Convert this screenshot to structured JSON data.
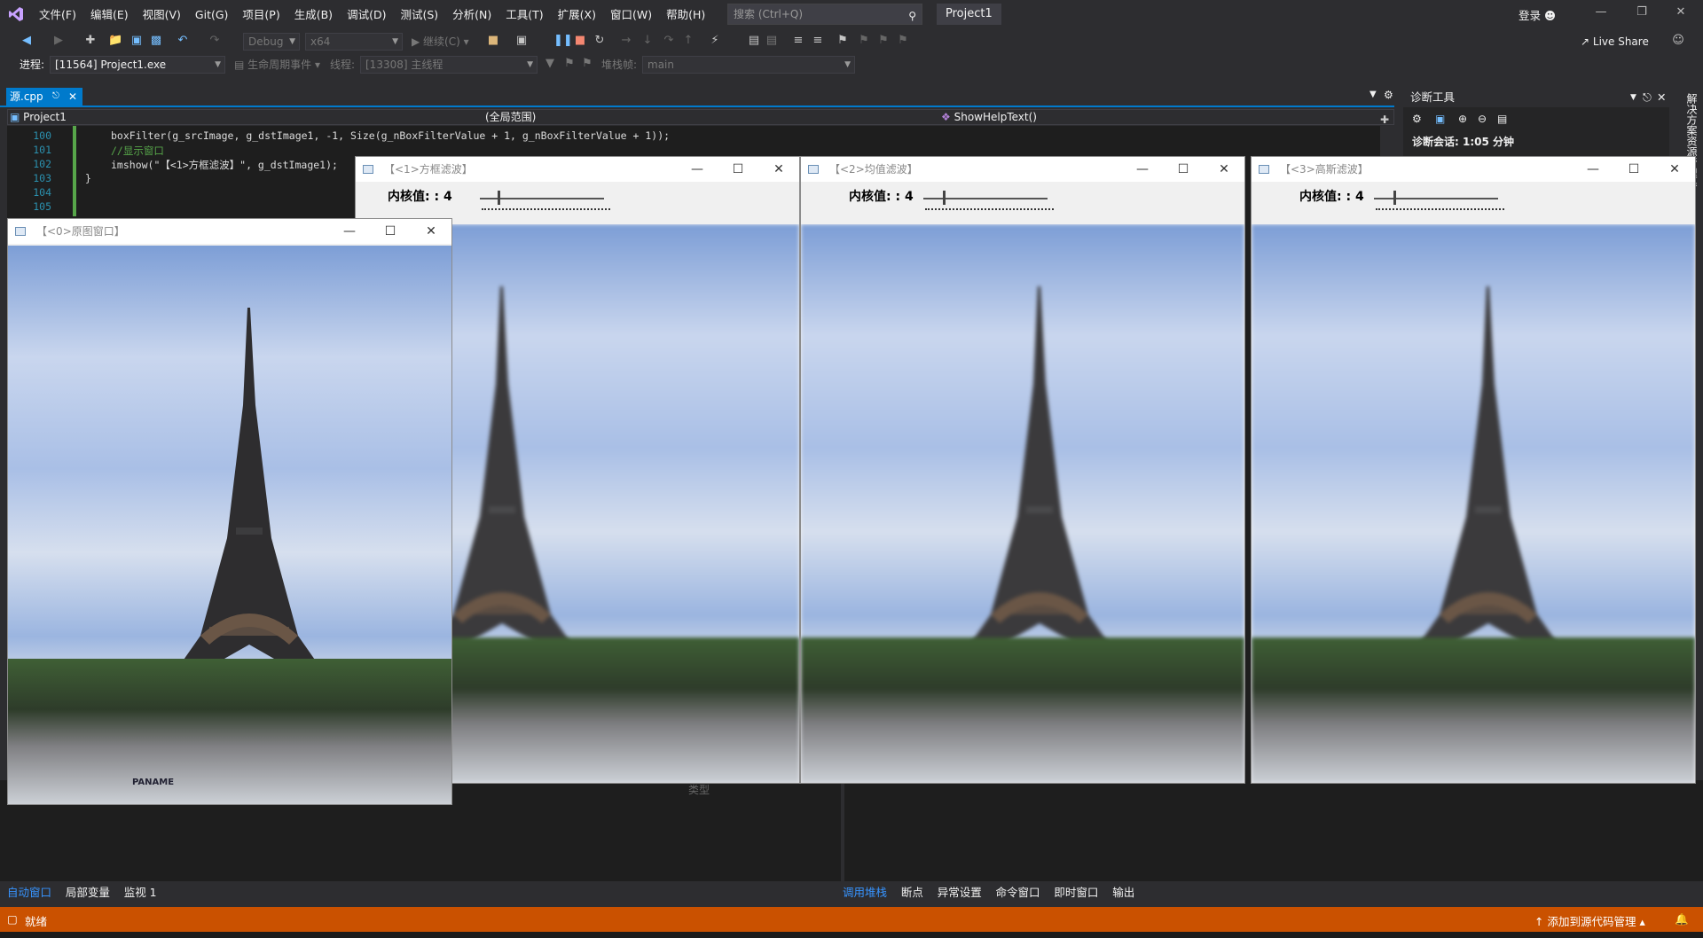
{
  "menubar": {
    "items": [
      "文件(F)",
      "编辑(E)",
      "视图(V)",
      "Git(G)",
      "项目(P)",
      "生成(B)",
      "调试(D)",
      "测试(S)",
      "分析(N)",
      "工具(T)",
      "扩展(X)",
      "窗口(W)",
      "帮助(H)"
    ],
    "search_placeholder": "搜索 (Ctrl+Q)",
    "project_name": "Project1",
    "login": "登录"
  },
  "toolbar": {
    "config": "Debug",
    "platform": "x64",
    "continue": "继续(C)",
    "live_share": "Live Share"
  },
  "debugbar": {
    "process_label": "进程:",
    "process_value": "[11564] Project1.exe",
    "lifecycle": "生命周期事件",
    "thread_label": "线程:",
    "thread_value": "[13308] 主线程",
    "stack_label": "堆栈帧:",
    "stack_value": "main"
  },
  "editor": {
    "tab_name": "源.cpp",
    "nav_project": "Project1",
    "nav_scope": "(全局范围)",
    "nav_function": "ShowHelpText()",
    "lines": [
      {
        "num": "100",
        "text": "boxFilter(g_srcImage, g_dstImage1, -1, Size(g_nBoxFilterValue + 1, g_nBoxFilterValue + 1));"
      },
      {
        "num": "101",
        "text": "//显示窗口"
      },
      {
        "num": "102",
        "text": "imshow(\"【<1>方框滤波】\", g_dstImage1);"
      },
      {
        "num": "103",
        "text": "}"
      },
      {
        "num": "104",
        "text": ""
      },
      {
        "num": "105",
        "text": ""
      }
    ]
  },
  "diag": {
    "title": "诊断工具",
    "session": "诊断会话: 1:05 分钟",
    "side_tab": "解决方案资源管理器"
  },
  "windows": [
    {
      "title": "【<0>原图窗口】"
    },
    {
      "title": "【<1>方框滤波】",
      "label": "内核值:",
      "value": "4"
    },
    {
      "title": "【<2>均值滤波】",
      "label": "内核值:",
      "value": "4"
    },
    {
      "title": "【<3>高斯滤波】",
      "label": "内核值:",
      "value": "4"
    }
  ],
  "photo_caption": "PANAME",
  "bottom": {
    "left_tabs": [
      "自动窗口",
      "局部变量",
      "监视 1"
    ],
    "right_tabs": [
      "调用堆栈",
      "断点",
      "异常设置",
      "命令窗口",
      "即时窗口",
      "输出"
    ],
    "type_col": "类型"
  },
  "status": {
    "ready": "就绪",
    "source_control": "添加到源代码管理"
  },
  "colors": {
    "accent": "#007acc",
    "status_bar": "#ca5100"
  }
}
